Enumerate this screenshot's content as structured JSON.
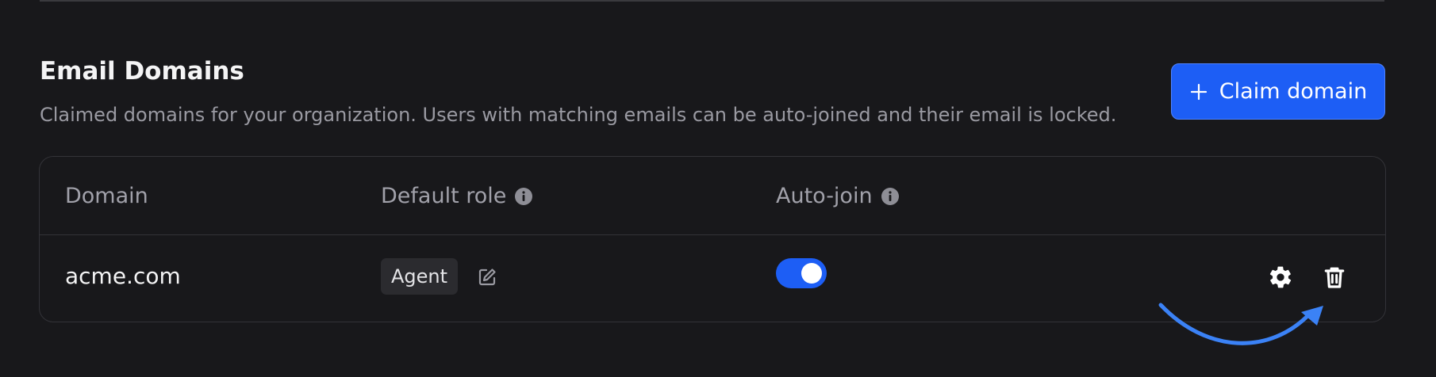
{
  "section": {
    "title": "Email Domains",
    "description": "Claimed domains for your organization. Users with matching emails can be auto-joined and their email is locked."
  },
  "claim_button": {
    "label": "Claim domain",
    "icon": "plus-icon"
  },
  "table": {
    "columns": [
      {
        "label": "Domain",
        "info_icon": false
      },
      {
        "label": "Default role",
        "info_icon": true
      },
      {
        "label": "Auto-join",
        "info_icon": true
      }
    ],
    "rows": [
      {
        "domain": "acme.com",
        "default_role": "Agent",
        "auto_join": true,
        "actions": [
          "gear-icon",
          "trash-icon"
        ]
      }
    ]
  },
  "annotation": {
    "type": "curved-arrow",
    "points_to": "trash-icon",
    "color": "#3b82f6"
  },
  "colors": {
    "background": "#18181b",
    "accent": "#1d5ef5",
    "border": "#333338",
    "muted_text": "#9a9aa2"
  }
}
